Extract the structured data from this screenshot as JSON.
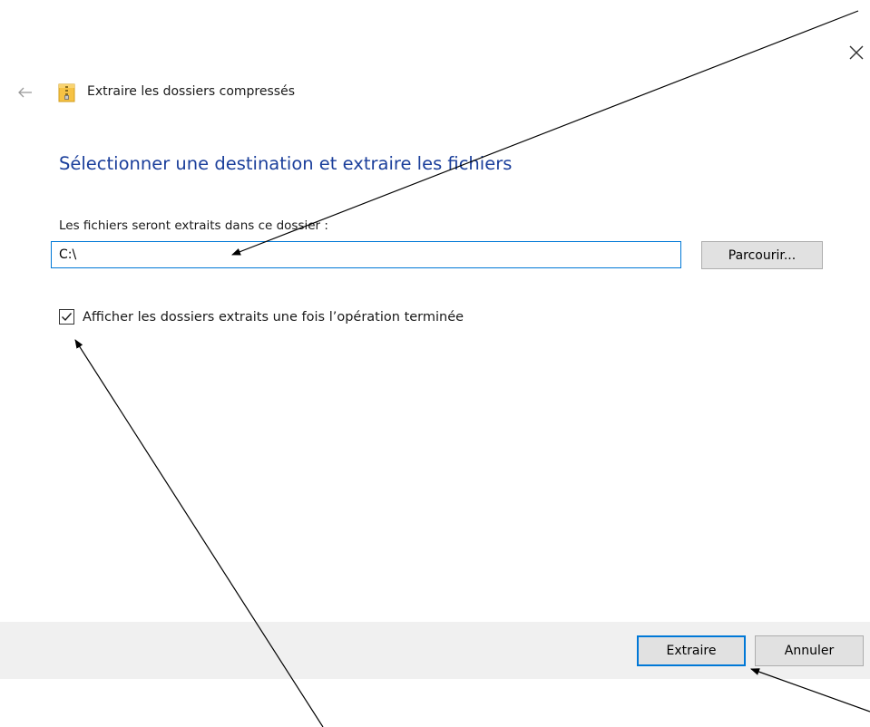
{
  "window": {
    "title": "Extraire les dossiers compressés",
    "close_icon": "close-icon",
    "back_icon": "back-arrow-icon",
    "wizard_icon": "zip-folder-icon"
  },
  "wizard": {
    "heading": "Sélectionner une destination et extraire les fichiers",
    "destination_label": "Les fichiers seront extraits dans ce dossier :",
    "destination_value": "C:\\",
    "browse_label": "Parcourir...",
    "show_folders_label": "Afficher les dossiers extraits une fois l’opération terminée",
    "show_folders_checked": true
  },
  "footer": {
    "extract_label": "Extraire",
    "cancel_label": "Annuler"
  },
  "colors": {
    "heading": "#1b3f9b",
    "accent": "#0078d7",
    "footer_background": "#f0f0f0",
    "button_background": "#e1e1e1"
  }
}
